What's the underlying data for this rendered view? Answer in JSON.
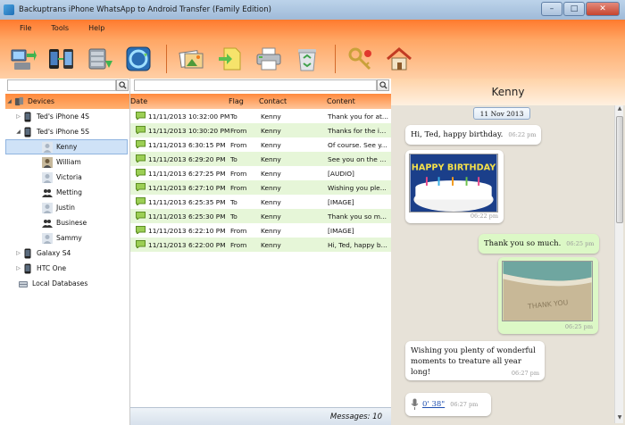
{
  "window": {
    "title": "Backuptrans iPhone WhatsApp to Android Transfer (Family Edition)",
    "minimize": "–",
    "maximize": "□",
    "close": "✕"
  },
  "menu": [
    "File",
    "Tools",
    "Help"
  ],
  "toolbar_icons": [
    "backup-to-pc-icon",
    "transfer-to-phone-icon",
    "database-export-icon",
    "sync-icon",
    "export-photos-icon",
    "export-file-icon",
    "print-icon",
    "recycle-icon",
    "key-icon",
    "home-icon"
  ],
  "tree": {
    "root": "Devices",
    "devices": [
      {
        "label": "Ted's iPhone 4S",
        "expanded": false
      },
      {
        "label": "Ted's iPhone 5S",
        "expanded": true,
        "contacts": [
          "Kenny",
          "William",
          "Victoria",
          "Metting",
          "Justin",
          "Businese",
          "Sammy"
        ]
      },
      {
        "label": "Galaxy S4",
        "expanded": false
      },
      {
        "label": "HTC One",
        "expanded": false
      }
    ],
    "local": "Local Databases"
  },
  "list": {
    "headers": {
      "date": "Date",
      "flag": "Flag",
      "contact": "Contact",
      "content": "Content"
    },
    "rows": [
      {
        "date": "11/11/2013 10:32:00 PM",
        "flag": "To",
        "contact": "Kenny",
        "content": "Thank you for at..."
      },
      {
        "date": "11/11/2013 10:30:20 PM",
        "flag": "From",
        "contact": "Kenny",
        "content": "Thanks for the in..."
      },
      {
        "date": "11/11/2013 6:30:15 PM",
        "flag": "From",
        "contact": "Kenny",
        "content": "Of course. See y..."
      },
      {
        "date": "11/11/2013 6:29:20 PM",
        "flag": "To",
        "contact": "Kenny",
        "content": "See you on the p..."
      },
      {
        "date": "11/11/2013 6:27:25 PM",
        "flag": "From",
        "contact": "Kenny",
        "content": "[AUDIO]"
      },
      {
        "date": "11/11/2013 6:27:10 PM",
        "flag": "From",
        "contact": "Kenny",
        "content": "Wishing you ple..."
      },
      {
        "date": "11/11/2013 6:25:35 PM",
        "flag": "To",
        "contact": "Kenny",
        "content": "[IMAGE]"
      },
      {
        "date": "11/11/2013 6:25:30 PM",
        "flag": "To",
        "contact": "Kenny",
        "content": "Thank you so m..."
      },
      {
        "date": "11/11/2013 6:22:10 PM",
        "flag": "From",
        "contact": "Kenny",
        "content": "[IMAGE]"
      },
      {
        "date": "11/11/2013 6:22:00 PM",
        "flag": "From",
        "contact": "Kenny",
        "content": "Hi, Ted, happy bi..."
      }
    ],
    "status": "Messages: 10"
  },
  "chat": {
    "contact": "Kenny",
    "date_chip": "11 Nov 2013",
    "messages": [
      {
        "dir": "in",
        "text": "Hi, Ted, happy birthday.",
        "time": "06:22 pm"
      },
      {
        "dir": "in",
        "image": "birthday-cake",
        "cake_text": "HAPPY BIRTHDAY",
        "time": "06:22 pm"
      },
      {
        "dir": "out",
        "text": "Thank you so much.",
        "time": "06:25 pm"
      },
      {
        "dir": "out",
        "image": "beach",
        "sand_text": "THANK YOU",
        "time": "06:25 pm"
      },
      {
        "dir": "in",
        "text_lines": [
          "Wishing you plenty of wonderful",
          "moments to treature all year long!"
        ],
        "time": "06:27 pm"
      },
      {
        "dir": "in",
        "audio": "0' 38\"",
        "time": "06:27 pm"
      }
    ]
  },
  "colors": {
    "accent": "#ff7a2e",
    "incoming": "#ffffff",
    "outgoing": "#dcf8c6",
    "row_alt": "#e6f6d8",
    "chat_bg": "#e7e2d8"
  }
}
